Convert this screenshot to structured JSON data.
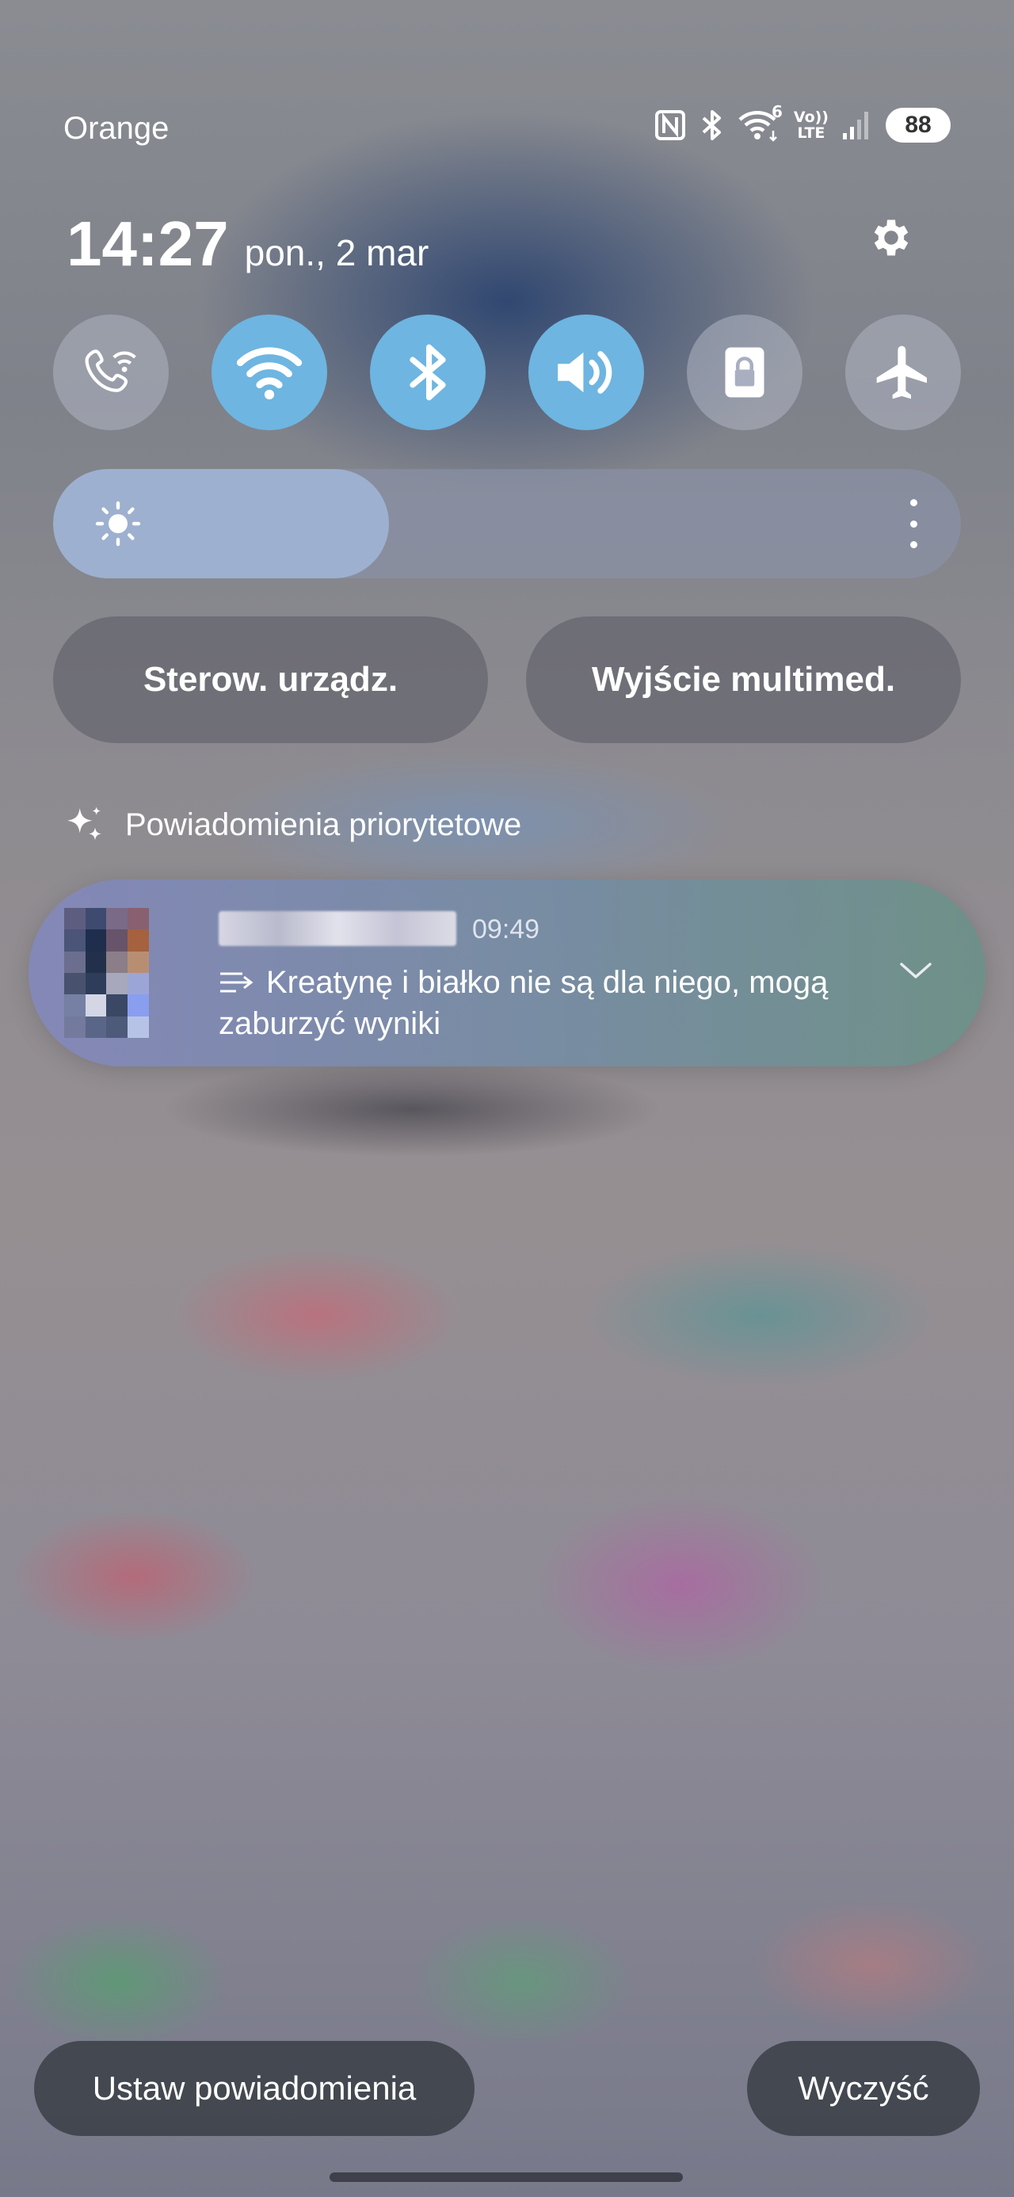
{
  "status_bar": {
    "carrier": "Orange",
    "icons": [
      "nfc-icon",
      "bluetooth-icon",
      "wifi-6-icon",
      "volte-lte-icon",
      "signal-icon"
    ],
    "wifi_standard": "6",
    "volte_top": "Vo))",
    "volte_bottom": "LTE",
    "battery_level": "88"
  },
  "header": {
    "time": "14:27",
    "date": "pon., 2 mar"
  },
  "quick_toggles": [
    {
      "icon": "wifi-calling-icon",
      "on": false
    },
    {
      "icon": "wifi-icon",
      "on": true
    },
    {
      "icon": "bluetooth-icon",
      "on": true
    },
    {
      "icon": "sound-icon",
      "on": true
    },
    {
      "icon": "secure-folder-icon",
      "on": false
    },
    {
      "icon": "airplane-mode-icon",
      "on": false
    }
  ],
  "brightness": {
    "level": 0.37
  },
  "controls": {
    "device_control_label": "Sterow. urządz.",
    "media_output_label": "Wyjście multimed."
  },
  "priority_notifications": {
    "header": "Powiadomienia priorytetowe",
    "items": [
      {
        "time": "09:49",
        "message": "Kreatynę i białko nie są dla niego, mogą zaburzyć wyniki"
      }
    ]
  },
  "footer": {
    "settings_label": "Ustaw powiadomienia",
    "clear_label": "Wyczyść"
  },
  "colors": {
    "toggle_on": "#6eb5e1",
    "toggle_off": "#a9aec1"
  }
}
